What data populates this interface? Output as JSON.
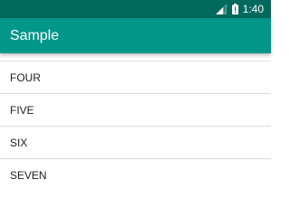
{
  "status_bar": {
    "time": "1:40",
    "icons": [
      "signal-icon",
      "battery-icon"
    ],
    "background_color": "#00695c"
  },
  "app_bar": {
    "title": "Sample",
    "background_color": "#009688"
  },
  "list": {
    "items": [
      {
        "label": "FOUR"
      },
      {
        "label": "FIVE"
      },
      {
        "label": "SIX"
      },
      {
        "label": "SEVEN"
      }
    ]
  }
}
